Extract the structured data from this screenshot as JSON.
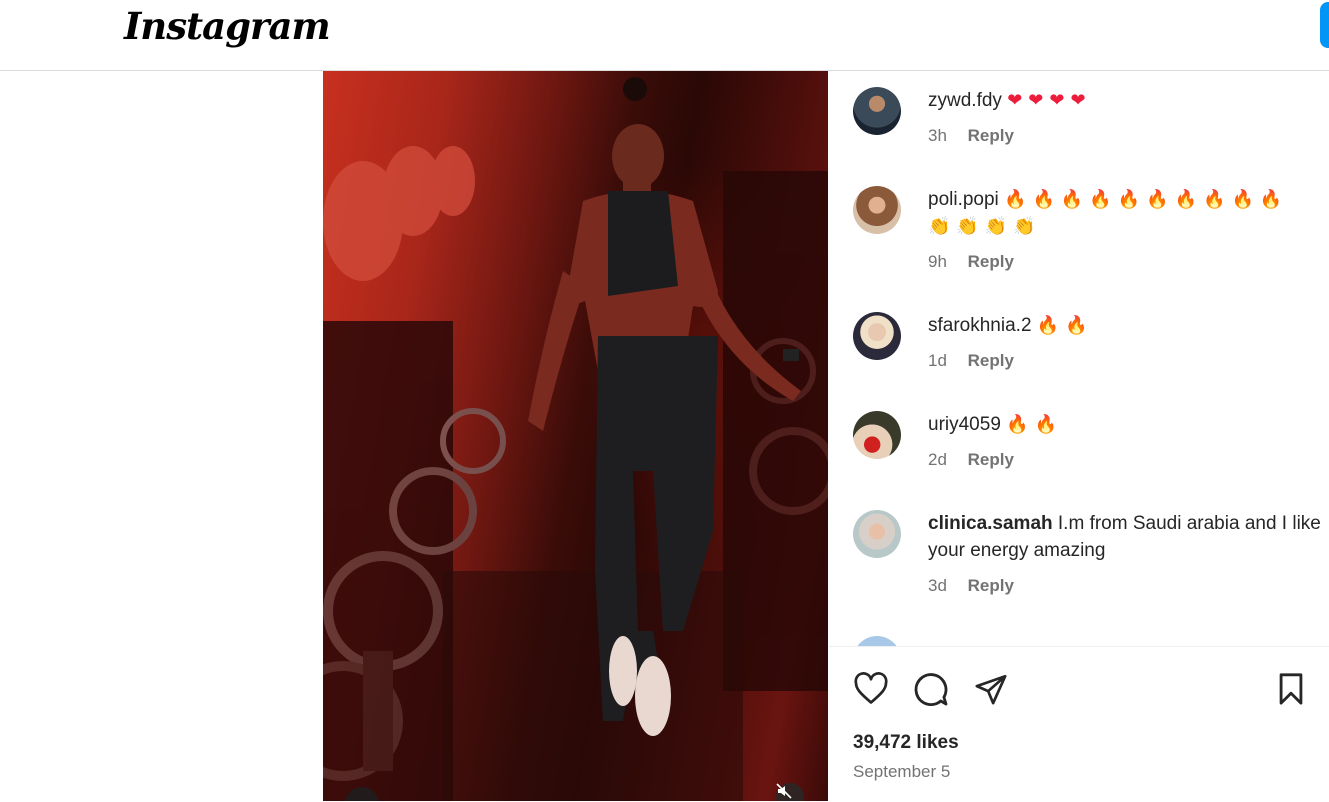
{
  "app": {
    "logo_text": "Instagram"
  },
  "comments": [
    {
      "username": "zywd.fdy",
      "text": "",
      "emojis": [
        "❤",
        "❤",
        "❤",
        "❤"
      ],
      "age": "3h",
      "reply_label": "Reply"
    },
    {
      "username": "poli.popi",
      "text": "",
      "emojis_line1": [
        "🔥",
        "🔥",
        "🔥",
        "🔥",
        "🔥",
        "🔥",
        "🔥",
        "🔥",
        "🔥",
        "🔥"
      ],
      "emojis_line2": [
        "👏",
        "👏",
        "👏",
        "👏"
      ],
      "age": "9h",
      "reply_label": "Reply"
    },
    {
      "username": "sfarokhnia.2",
      "text": "",
      "emojis": [
        "🔥",
        "🔥"
      ],
      "age": "1d",
      "reply_label": "Reply"
    },
    {
      "username": "uriy4059",
      "text": "",
      "emojis": [
        "🔥",
        "🔥"
      ],
      "age": "2d",
      "reply_label": "Reply"
    },
    {
      "username": "clinica.samah",
      "text": "I.m from Saudi arabia and I like your energy amazing",
      "age": "3d",
      "reply_label": "Reply"
    }
  ],
  "post": {
    "likes": "39,472 likes",
    "date": "September 5"
  },
  "icons": {
    "like": "heart-icon",
    "comment": "comment-icon",
    "share": "share-icon",
    "save": "bookmark-icon",
    "mute": "muted-speaker-icon"
  },
  "colors": {
    "accent": "#0095f6",
    "heart": "#ed1c3a",
    "muted_text": "#737373"
  }
}
